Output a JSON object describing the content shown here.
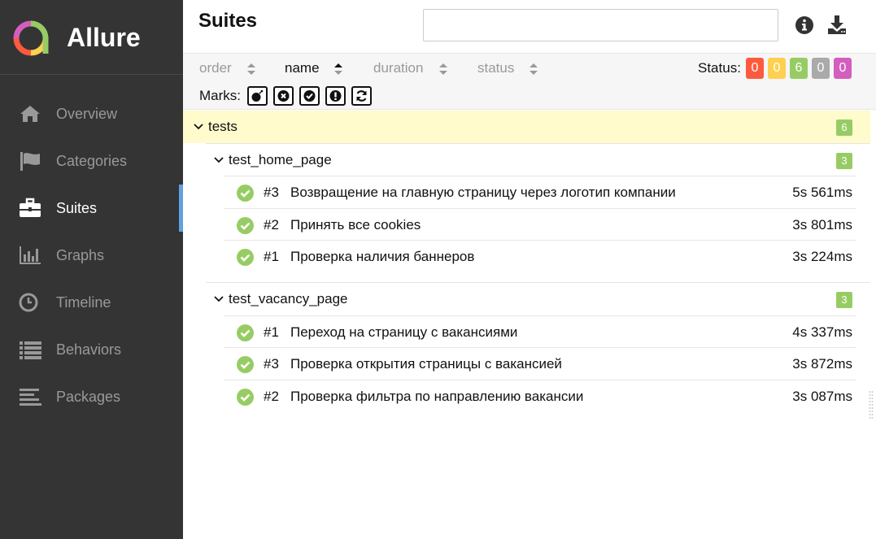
{
  "brand": {
    "name": "Allure"
  },
  "sidebar": {
    "items": [
      {
        "label": "Overview",
        "icon": "home-icon",
        "active": false
      },
      {
        "label": "Categories",
        "icon": "flag-icon",
        "active": false
      },
      {
        "label": "Suites",
        "icon": "briefcase-icon",
        "active": true
      },
      {
        "label": "Graphs",
        "icon": "bar-chart-icon",
        "active": false
      },
      {
        "label": "Timeline",
        "icon": "clock-icon",
        "active": false
      },
      {
        "label": "Behaviors",
        "icon": "list-icon",
        "active": false
      },
      {
        "label": "Packages",
        "icon": "align-left-icon",
        "active": false
      }
    ]
  },
  "header": {
    "title": "Suites",
    "search": {
      "value": "",
      "placeholder": ""
    }
  },
  "toolbar": {
    "sorters": [
      {
        "label": "order",
        "active": false
      },
      {
        "label": "name",
        "active": true
      },
      {
        "label": "duration",
        "active": false
      },
      {
        "label": "status",
        "active": false
      }
    ],
    "status_label": "Status:",
    "status_counts": [
      {
        "status": "failed",
        "count": "0",
        "color": "#fd5a3e"
      },
      {
        "status": "broken",
        "count": "0",
        "color": "#ffd050"
      },
      {
        "status": "passed",
        "count": "6",
        "color": "#97cc64"
      },
      {
        "status": "skipped",
        "count": "0",
        "color": "#aaaaaa"
      },
      {
        "status": "unknown",
        "count": "0",
        "color": "#d35ebe"
      }
    ],
    "marks_label": "Marks:",
    "marks": [
      "bomb-icon",
      "times-circle-icon",
      "check-circle-icon",
      "exclamation-icon",
      "refresh-icon"
    ]
  },
  "tree": {
    "name": "tests",
    "count": "6",
    "groups": [
      {
        "name": "test_home_page",
        "count": "3",
        "tests": [
          {
            "num": "#3",
            "name": "Возвращение на главную страницу через логотип компании",
            "duration": "5s 561ms",
            "status": "passed"
          },
          {
            "num": "#2",
            "name": "Принять все cookies",
            "duration": "3s 801ms",
            "status": "passed"
          },
          {
            "num": "#1",
            "name": "Проверка наличия баннеров",
            "duration": "3s 224ms",
            "status": "passed"
          }
        ]
      },
      {
        "name": "test_vacancy_page",
        "count": "3",
        "tests": [
          {
            "num": "#1",
            "name": "Переход на страницу с вакансиями",
            "duration": "4s 337ms",
            "status": "passed"
          },
          {
            "num": "#3",
            "name": "Проверка открытия страницы с вакансией",
            "duration": "3s 872ms",
            "status": "passed"
          },
          {
            "num": "#2",
            "name": "Проверка фильтра по направлению вакансии",
            "duration": "3s 087ms",
            "status": "passed"
          }
        ]
      }
    ]
  },
  "colors": {
    "sidebar_bg": "#343434",
    "accent": "#5fa2dd",
    "passed": "#97cc64",
    "highlight_row": "#fffbcc"
  }
}
